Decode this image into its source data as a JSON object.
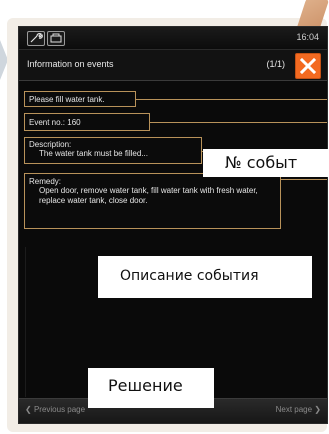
{
  "status_bar": {
    "time": "16:04",
    "icons": [
      "wrench-icon",
      "tray-icon"
    ]
  },
  "title_bar": {
    "title": "Information on events",
    "page_count": "(1/1)",
    "close_icon": "close-icon",
    "close_color": "#f36a21"
  },
  "fields": {
    "message": "Please fill water tank.",
    "event_no": "Event no.: 160",
    "description_label": "Description:",
    "description_text": "The water tank must be filled...",
    "remedy_label": "Remedy:",
    "remedy_text": "Open door, remove water tank, fill water tank with fresh water, replace water tank, close door."
  },
  "navigation": {
    "prev_label": "Previous page",
    "next_label": "Next page"
  },
  "callouts": {
    "event_number": "№ событ",
    "event_description": "Описание события",
    "remedy": "Решение"
  },
  "colors": {
    "accent": "#b8925a",
    "screen_bg": "#0a0a0a"
  }
}
